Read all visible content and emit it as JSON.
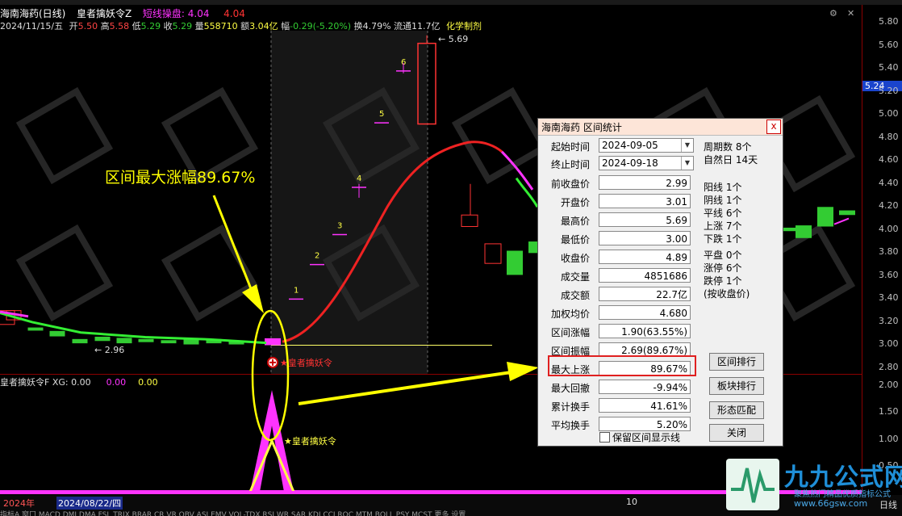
{
  "header": {
    "title": "海南海药(日线)",
    "indicator_name": "皇者擒妖令Z",
    "indicator_label": "短线操盘:",
    "indicator_val1": "4.04",
    "indicator_val2": "4.04"
  },
  "info": {
    "date": "2024/11/15/五",
    "open_label": "开",
    "open": "5.50",
    "high_label": "高",
    "high": "5.58",
    "low_label": "低",
    "low": "5.29",
    "close_label": "收",
    "close": "5.29",
    "vol_label": "量",
    "vol": "558710",
    "amount_label": "额",
    "amount": "3.04亿",
    "change_label": "幅",
    "change": "-0.29(-5.20%)",
    "turnover_label": "换",
    "turnover": "4.79%",
    "float_label": "流通",
    "float": "11.7亿",
    "sector": "化学制剂"
  },
  "price_axis": {
    "labels": [
      "5.80",
      "5.60",
      "5.40",
      "5.24",
      "5.20",
      "5.00",
      "4.80",
      "4.60",
      "4.40",
      "4.20",
      "4.00",
      "3.80",
      "3.60",
      "3.40",
      "3.20",
      "3.00",
      "2.80"
    ],
    "current": "5.24"
  },
  "sub_axis": {
    "labels": [
      "2.00",
      "1.50",
      "1.00",
      "0.50"
    ]
  },
  "chart_marks": {
    "low_mark": "2.96",
    "high_mark": "5.69",
    "steps": [
      "1",
      "2",
      "3",
      "4",
      "5",
      "6"
    ],
    "signal_label": "皇者擒妖令",
    "signal_label2": "皇者擒妖令"
  },
  "annotation": {
    "text": "区间最大涨幅89.67%"
  },
  "sub_header": {
    "name": "皇者擒妖令F",
    "xg_label": "XG:",
    "xg": "0.00",
    "v2": "0.00",
    "v3": "0.00"
  },
  "time_axis": {
    "year": "2024年",
    "date_tag": "2024/08/22/四",
    "mark10": "10",
    "right": "日线"
  },
  "tabs": "指标A 窗口 MACD DMI DMA FSL TRIX BRAR CR VR OBV ASI EMV VOL-TDX RSI WR SAR KDJ CCI ROC MTM BOLL PSY MCST 更多 设置",
  "dialog": {
    "title": "海南海药 区间统计",
    "close": "x",
    "start_label": "起始时间",
    "start": "2024-09-05",
    "end_label": "终止时间",
    "end": "2024-09-18",
    "rows": [
      {
        "label": "前收盘价",
        "value": "2.99"
      },
      {
        "label": "开盘价",
        "value": "3.01"
      },
      {
        "label": "最高价",
        "value": "5.69"
      },
      {
        "label": "最低价",
        "value": "3.00"
      },
      {
        "label": "收盘价",
        "value": "4.89"
      },
      {
        "label": "成交量",
        "value": "4851686"
      },
      {
        "label": "成交额",
        "value": "22.7亿"
      },
      {
        "label": "加权均价",
        "value": "4.680"
      },
      {
        "label": "区间涨幅",
        "value": "1.90(63.55%)"
      },
      {
        "label": "区间振幅",
        "value": "2.69(89.67%)"
      },
      {
        "label": "最大上涨",
        "value": "89.67%"
      },
      {
        "label": "最大回撤",
        "value": "-9.94%"
      },
      {
        "label": "累计换手",
        "value": "41.61%"
      },
      {
        "label": "平均换手",
        "value": "5.20%"
      }
    ],
    "stats": [
      "周期数 8个",
      "自然日 14天",
      "阳线 1个",
      "阴线 1个",
      "平线 6个",
      "上涨 7个",
      "下跌 1个",
      "平盘 0个",
      "涨停 6个",
      "跌停 1个",
      "(按收盘价)"
    ],
    "buttons": [
      "区间排行",
      "板块排行",
      "形态匹配",
      "关闭"
    ],
    "checkbox_label": "保留区间显示线"
  },
  "logo": {
    "text": "九九公式网",
    "sub": "聚焦热门精品优质指标公式",
    "url": "www.66gsw.com"
  },
  "colors": {
    "up": "#ff3333",
    "down": "#33cc33",
    "magenta": "#ff33ff",
    "yellow": "#ffff00",
    "accent": "#d02020"
  }
}
